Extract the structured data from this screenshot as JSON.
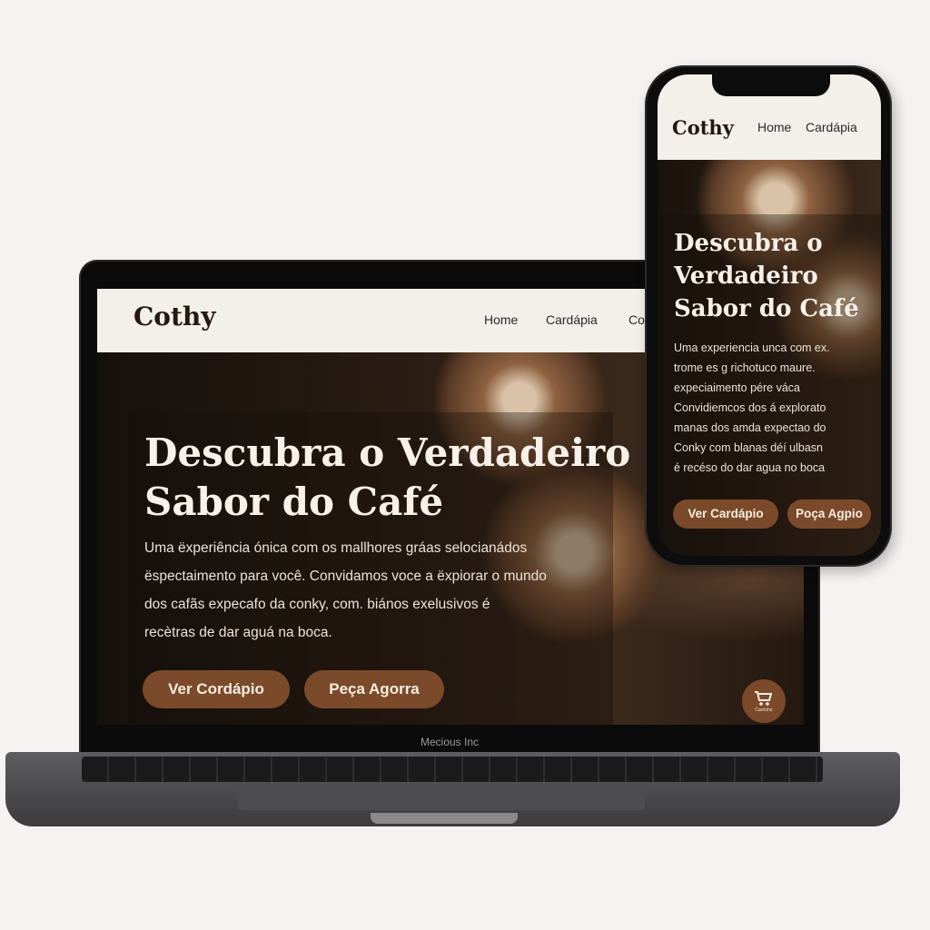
{
  "laptop": {
    "logo": "Cothy",
    "nav": [
      "Home",
      "Cardápia",
      "Co"
    ],
    "hero_title_line1": "Descubra o Verdadeiro",
    "hero_title_line2": "Sabor do Café",
    "hero_desc_lines": [
      "Uma ëxperiência ónica com os mallhores gráas selocianádos",
      "ëspectaimento para você. Convidamos voce a ëxpiorar o mundo",
      "dos cafãs expecafo da conky, com. biános exelusivos é",
      "recètras de dar aguá na boca."
    ],
    "button_primary": "Ver Cordápio",
    "button_secondary": "Peça Agorra",
    "cart_label": "Carrinho",
    "brand": "Mecious Inc"
  },
  "phone": {
    "logo": "Cothy",
    "nav": [
      "Home",
      "Cardápia"
    ],
    "hero_title_lines": [
      "Descubra o",
      "Verdadeiro",
      "Sabor do Café"
    ],
    "hero_desc_lines": [
      "Uma experiencia unca com ex.",
      "trome es g richotuco maure.",
      "expeciaimento pére váca",
      "Convidiemcos dos á explorato",
      "manas dos amda expectao do",
      "Conky com blanas déí ulbasn",
      "é recéso do dar agua no boca"
    ],
    "button_primary": "Ver Cardápio",
    "button_secondary": "Poça Agpio"
  },
  "colors": {
    "accent": "#7b4a2a",
    "nav_bg": "#f3efe9",
    "hero_text": "#f7f1ea"
  }
}
